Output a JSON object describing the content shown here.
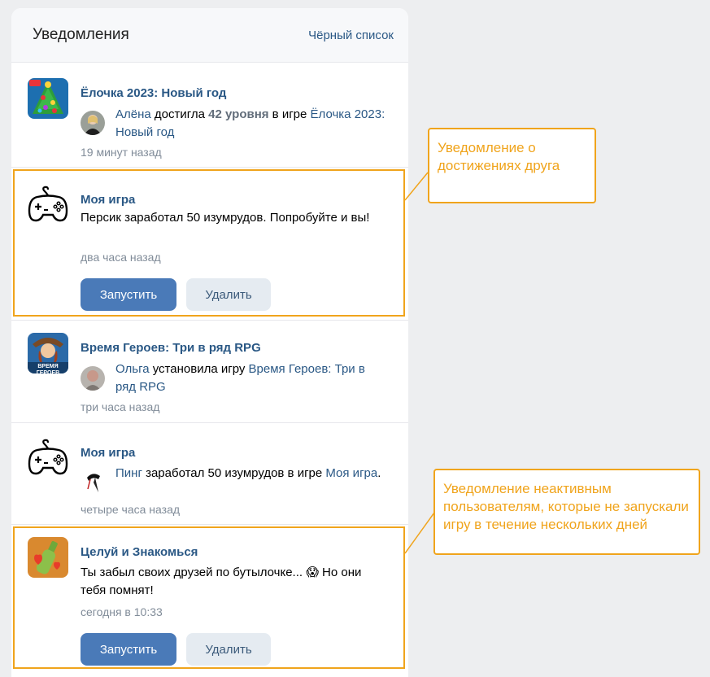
{
  "header": {
    "title": "Уведомления",
    "blacklist_link": "Чёрный список"
  },
  "notifications": [
    {
      "app_title": "Ёлочка 2023: Новый год",
      "actor": "Алёна",
      "text_1": " достигла ",
      "level": "42 уровня",
      "text_2": " в игре ",
      "game_link": "Ёлочка 2023: Новый год",
      "time": "19 минут назад"
    },
    {
      "app_title": "Моя игра",
      "body": "Персик заработал 50 изумрудов. Попробуйте и вы!",
      "time": "два часа назад",
      "launch_label": "Запустить",
      "delete_label": "Удалить"
    },
    {
      "app_title": "Время Героев: Три в ряд RPG",
      "icon_caption": "ВРЕМЯ ГЕРОЕВ",
      "actor": "Ольга",
      "text_1": " установила игру ",
      "game_link": "Время Героев: Три в ряд RPG",
      "time": "три часа назад"
    },
    {
      "app_title": "Моя игра",
      "actor": "Пинг",
      "text_1": " заработал 50 изумрудов в игре ",
      "game_link": "Моя игра",
      "text_2": ".",
      "time": "четыре часа назад"
    },
    {
      "app_title": "Целуй и Знакомься",
      "body_1": "Ты забыл своих друзей по бутылочке... ",
      "emoji": "😱",
      "body_2": " Но они тебя помнят!",
      "time": "сегодня в 10:33",
      "launch_label": "Запустить",
      "delete_label": "Удалить"
    }
  ],
  "callouts": {
    "friend_achievement": "Уведомление о достижениях друга",
    "inactive_users": "Уведомление неактивным пользователям, которые не запускали игру в течение нескольких дней"
  },
  "colors": {
    "link": "#2a5885",
    "accent": "#f0a41c",
    "primary_button": "#4a7ab8",
    "secondary_button": "#e5ebf1",
    "muted": "#818c99"
  }
}
